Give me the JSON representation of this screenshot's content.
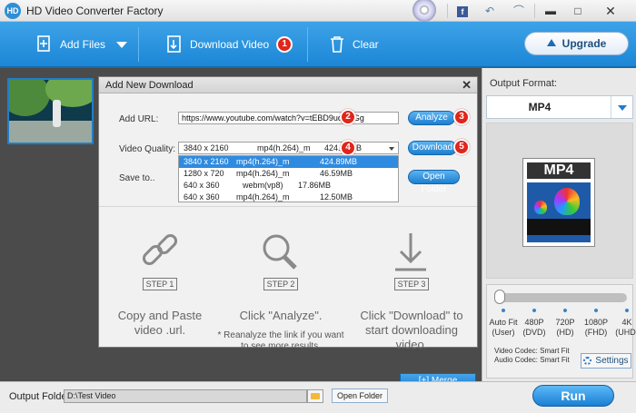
{
  "app": {
    "title": "HD Video Converter Factory",
    "logo_text": "HD"
  },
  "titlebar_buttons": [
    "facebook-icon",
    "undo-icon",
    "skin-icon",
    "minimize-icon",
    "close-icon"
  ],
  "toolbar": {
    "add_files": "Add Files",
    "download_video": "Download Video",
    "download_badge": "1",
    "clear": "Clear",
    "upgrade": "Upgrade"
  },
  "right_panel": {
    "output_format_label": "Output Format:",
    "format": "MP4",
    "file_icon_label": "MP4",
    "quality_level": 0,
    "quality_options": [
      {
        "label": "Auto Fit\n(User)"
      },
      {
        "label": "480P\n(DVD)"
      },
      {
        "label": "720P\n(HD)"
      },
      {
        "label": "1080P\n(FHD)"
      },
      {
        "label": "4K\n(UHD)"
      }
    ],
    "video_codec": "Video Codec: Smart Fit",
    "audio_codec": "Audio Codec: Smart Fit",
    "settings": "Settings"
  },
  "dialog": {
    "title": "Add New Download",
    "close": "✕",
    "url_label": "Add URL:",
    "url_value": "https://www.youtube.com/watch?v=tEBD9uqzMGg",
    "url_badge": "2",
    "analyze": "Analyze",
    "analyze_badge": "3",
    "quality_label": "Video Quality:",
    "quality_selected": {
      "res": "3840 x 2160",
      "codec": "mp4(h.264)_m",
      "size": "424.89MB"
    },
    "quality_badge": "4",
    "download": "Download",
    "download_badge": "5",
    "save_label": "Save to..",
    "open_folder": "Open Folder",
    "quality_options": [
      {
        "res": "3840 x 2160",
        "codec": "mp4(h.264)_m",
        "size": "424.89MB"
      },
      {
        "res": "1280 x 720",
        "codec": "mp4(h.264)_m",
        "size": "46.59MB"
      },
      {
        "res": "640 x 360",
        "codec": "webm(vp8)",
        "size": "17.86MB"
      },
      {
        "res": "640 x 360",
        "codec": "mp4(h.264)_m",
        "size": "12.50MB"
      }
    ],
    "steps": [
      {
        "tag": "STEP 1",
        "text": "Copy and Paste video .url.",
        "icon": "link-icon"
      },
      {
        "tag": "STEP 2",
        "text": "Click \"Analyze\".",
        "note": "* Reanalyze the link if you want to see more results.",
        "icon": "magnifier-icon"
      },
      {
        "tag": "STEP 3",
        "text": "Click \"Download\" to start downloading video.",
        "icon": "download-arrow-icon"
      }
    ]
  },
  "merge": "[+] Merge",
  "bottom": {
    "output_folder_label": "Output Folder:",
    "output_folder_value": "D:\\Test Video",
    "open_folder": "Open Folder",
    "run": "Run"
  }
}
